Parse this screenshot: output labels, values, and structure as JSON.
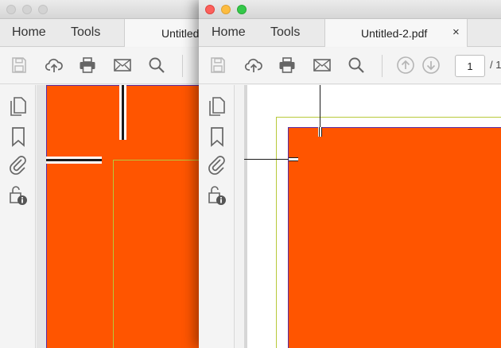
{
  "back_window": {
    "menu": {
      "home": "Home",
      "tools": "Tools"
    },
    "tab": {
      "title": "Untitled"
    }
  },
  "front_window": {
    "menu": {
      "home": "Home",
      "tools": "Tools"
    },
    "tab": {
      "title": "Untitled-2.pdf",
      "close": "×"
    },
    "toolbar": {
      "page_number": "1",
      "page_total": "/ 1"
    }
  },
  "icons": {
    "toolbar": [
      "save-icon",
      "upload-cloud-icon",
      "print-icon",
      "mail-icon",
      "search-icon",
      "page-up-icon",
      "page-down-icon"
    ],
    "sidebar": [
      "pages-icon",
      "bookmark-icon",
      "attachment-icon",
      "security-info-icon"
    ]
  },
  "colors": {
    "page_fill": "#ff5500",
    "bleed_border": "#5a2aa0",
    "trim_line": "#b8c93a",
    "close_button": "#fc605c",
    "minimize_button": "#fdbc40",
    "zoom_button": "#34c84a"
  }
}
